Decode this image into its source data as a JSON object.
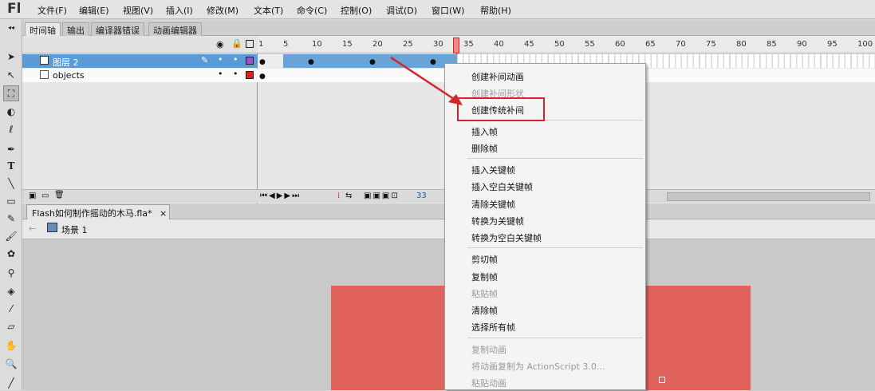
{
  "app": {
    "logo": "Fl"
  },
  "menubar": {
    "items": [
      "文件(F)",
      "编辑(E)",
      "视图(V)",
      "插入(I)",
      "修改(M)",
      "文本(T)",
      "命令(C)",
      "控制(O)",
      "调试(D)",
      "窗口(W)",
      "帮助(H)"
    ]
  },
  "panel_tabs": [
    "时间轴",
    "输出",
    "编译器错误",
    "动画编辑器"
  ],
  "timeline": {
    "ruler_labels": [
      "1",
      "5",
      "10",
      "15",
      "20",
      "25",
      "30",
      "35",
      "40",
      "45",
      "50",
      "55",
      "60",
      "65",
      "70",
      "75",
      "80",
      "85",
      "90",
      "95",
      "100"
    ],
    "layers": [
      {
        "name": "图层 2",
        "selected": true,
        "color": "#9b4fd1"
      },
      {
        "name": "objects",
        "selected": false,
        "color": "#e02020"
      }
    ],
    "current_frame": "33",
    "selected_span_color": "#6aa3d8"
  },
  "document": {
    "tab_title": "Flash如何制作摇动的木马.fla*",
    "tab_close": "×",
    "scene_label": "场景 1",
    "stage_color": "#e0625a"
  },
  "context_menu": {
    "groups": [
      [
        {
          "label": "创建补间动画",
          "disabled": false
        },
        {
          "label": "创建补间形状",
          "disabled": true
        },
        {
          "label": "创建传统补间",
          "disabled": false,
          "highlighted": true
        }
      ],
      [
        {
          "label": "插入帧",
          "disabled": false
        },
        {
          "label": "删除帧",
          "disabled": false
        }
      ],
      [
        {
          "label": "插入关键帧",
          "disabled": false
        },
        {
          "label": "插入空白关键帧",
          "disabled": false
        },
        {
          "label": "清除关键帧",
          "disabled": false
        },
        {
          "label": "转换为关键帧",
          "disabled": false
        },
        {
          "label": "转换为空白关键帧",
          "disabled": false
        }
      ],
      [
        {
          "label": "剪切帧",
          "disabled": false
        },
        {
          "label": "复制帧",
          "disabled": false
        },
        {
          "label": "粘贴帧",
          "disabled": true
        },
        {
          "label": "清除帧",
          "disabled": false
        },
        {
          "label": "选择所有帧",
          "disabled": false
        }
      ],
      [
        {
          "label": "复制动画",
          "disabled": true
        },
        {
          "label": "将动画复制为 ActionScript 3.0...",
          "disabled": true
        },
        {
          "label": "粘贴动画",
          "disabled": true
        }
      ]
    ]
  },
  "annotation": {
    "box_color": "#d3252b",
    "arrow_color": "#d3252b"
  },
  "icons": {
    "eye": "eye-icon",
    "lock": "lock-icon",
    "outline": "outline-icon",
    "layer": "layer-icon",
    "pencil": "pencil-icon",
    "scene": "scene-icon",
    "back": "back-arrow-icon"
  }
}
